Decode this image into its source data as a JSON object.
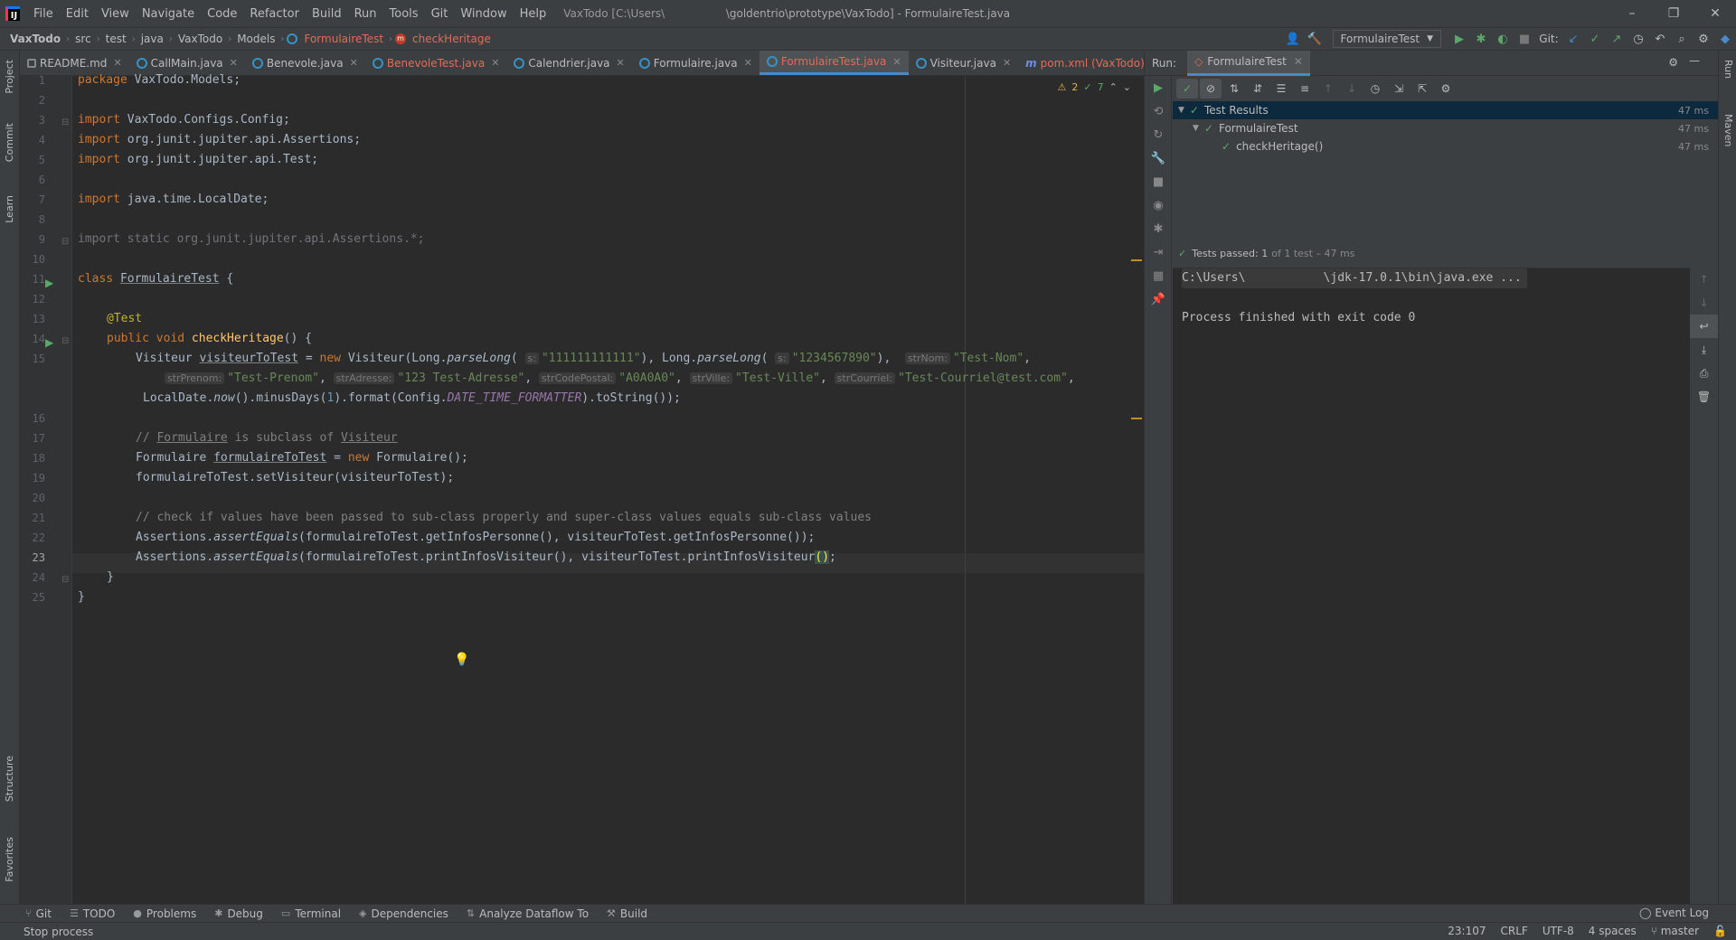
{
  "menubar": {
    "items": [
      "File",
      "Edit",
      "View",
      "Navigate",
      "Code",
      "Refactor",
      "Build",
      "Run",
      "Tools",
      "Git",
      "Window",
      "Help"
    ],
    "project": "VaxTodo [C:\\Users\\",
    "window_title": "\\goldentrio\\prototype\\VaxTodo] - FormulaireTest.java",
    "minimize": "–",
    "restore": "❐",
    "close": "✕"
  },
  "breadcrumb": {
    "items": [
      "VaxTodo",
      "src",
      "test",
      "java",
      "VaxTodo",
      "Models",
      "FormulaireTest",
      "checkHeritage"
    ]
  },
  "toolbar": {
    "run_config": "FormulaireTest",
    "git_label": "Git:"
  },
  "tabs": [
    {
      "label": "README.md"
    },
    {
      "label": "CallMain.java"
    },
    {
      "label": "Benevole.java"
    },
    {
      "label": "BenevoleTest.java"
    },
    {
      "label": "Calendrier.java"
    },
    {
      "label": "Formulaire.java"
    },
    {
      "label": "FormulaireTest.java"
    },
    {
      "label": "Visiteur.java"
    },
    {
      "label": "pom.xml (VaxTodo)"
    }
  ],
  "editor": {
    "line_numbers": [
      "1",
      "2",
      "3",
      "4",
      "5",
      "6",
      "7",
      "8",
      "9",
      "10",
      "11",
      "12",
      "13",
      "14",
      "15",
      "",
      "",
      "16",
      "17",
      "18",
      "19",
      "20",
      "21",
      "22",
      "23",
      "24",
      "25"
    ],
    "inspections": {
      "warnings": "2",
      "ok": "7"
    },
    "code": {
      "l1_kw": "package",
      "l1_rest": " VaxTodo.Models;",
      "l3_kw": "import",
      "l3_rest": " VaxTodo.Configs.Config;",
      "l4_kw": "import",
      "l4_rest": " org.junit.jupiter.api.Assertions;",
      "l5_kw": "import",
      "l5_rest": " org.junit.jupiter.api.Test;",
      "l7_kw": "import",
      "l7_rest": " java.time.LocalDate;",
      "l9": "import static org.junit.jupiter.api.Assertions.*;",
      "l11_kw": "class",
      "l11_name": "FormulaireTest",
      "l11_rest": " {",
      "l13": "@Test",
      "l14_kw": "public void",
      "l14_fn": "checkHeritage",
      "l14_rest": "() {",
      "l15_a": "Visiteur ",
      "l15_var": "visiteurToTest",
      "l15_b": " = ",
      "l15_new": "new",
      "l15_c": " Visiteur(Long.",
      "l15_pl1": "parseLong",
      "l15_d": "(",
      "hint_s": "s:",
      "l15_s1": "\"111111111111\"",
      "l15_e": "), Long.",
      "l15_pl2": "parseLong",
      "l15_f": "(",
      "l15_s2": "\"1234567890\"",
      "l15_g": "),",
      "hint_nom": "strNom:",
      "l15_s3": "\"Test-Nom\"",
      "comma": ",",
      "hint_prenom": "strPrenom:",
      "l15b_s1": "\"Test-Prenom\"",
      "hint_adresse": "strAdresse:",
      "l15b_s2": "\"123 Test-Adresse\"",
      "hint_cp": "strCodePostal:",
      "l15b_s3": "\"A0A0A0\"",
      "hint_ville": "strVille:",
      "l15b_s4": "\"Test-Ville\"",
      "hint_courriel": "strCourriel:",
      "l15b_s5": "\"Test-Courriel@test.com\"",
      "l15c_a": "LocalDate.",
      "l15c_now": "now",
      "l15c_b": "().minusDays(",
      "l15c_num": "1",
      "l15c_c": ").format(Config.",
      "l15c_const": "DATE_TIME_FORMATTER",
      "l15c_d": ").toString());",
      "l17_a": "// ",
      "l17_b": "Formulaire",
      "l17_c": " is subclass of ",
      "l17_d": "Visiteur",
      "l18_a": "Formulaire ",
      "l18_var": "formulaireToTest",
      "l18_b": " = ",
      "l18_new": "new",
      "l18_c": " Formulaire();",
      "l19": "formulaireToTest.setVisiteur(visiteurToTest);",
      "l21": "// check if values have been passed to sub-class properly and super-class values equals sub-class values",
      "l22_a": "Assertions.",
      "l22_fn": "assertEquals",
      "l22_b": "(formulaireToTest.getInfosPersonne(), visiteurToTest.getInfosPersonne());",
      "l23_a": "Assertions.",
      "l23_fn": "assertEquals",
      "l23_b": "(formulaireToTest.printInfosVisiteur(), visiteurToTest.printInfosVisiteur",
      "l23_paren": "()",
      "l23_c": ";",
      "l24": "}",
      "l25": "}"
    }
  },
  "run_panel": {
    "label": "Run:",
    "tab": "FormulaireTest",
    "tree": [
      {
        "label": "Test Results",
        "time": "47 ms"
      },
      {
        "label": "FormulaireTest",
        "time": "47 ms"
      },
      {
        "label": "checkHeritage()",
        "time": "47 ms"
      }
    ],
    "passed": "Tests passed: 1",
    "passed_detail": "of 1 test – 47 ms",
    "console": {
      "cmd_a": "C:\\Users\\",
      "cmd_b": "\\jdk-17.0.1\\bin\\java.exe ...",
      "exit": "Process finished with exit code 0"
    }
  },
  "left_strip": [
    "Project",
    "Commit",
    "Learn",
    "Structure",
    "Favorites"
  ],
  "right_strip": [
    "Run",
    "Maven"
  ],
  "bottom_tools": [
    "Git",
    "TODO",
    "Problems",
    "Debug",
    "Terminal",
    "Dependencies",
    "Analyze Dataflow To",
    "Build"
  ],
  "event_log": "Event Log",
  "status": {
    "left": "Stop process",
    "position": "23:107",
    "line_sep": "CRLF",
    "encoding": "UTF-8",
    "indent": "4 spaces",
    "branch": "master"
  }
}
